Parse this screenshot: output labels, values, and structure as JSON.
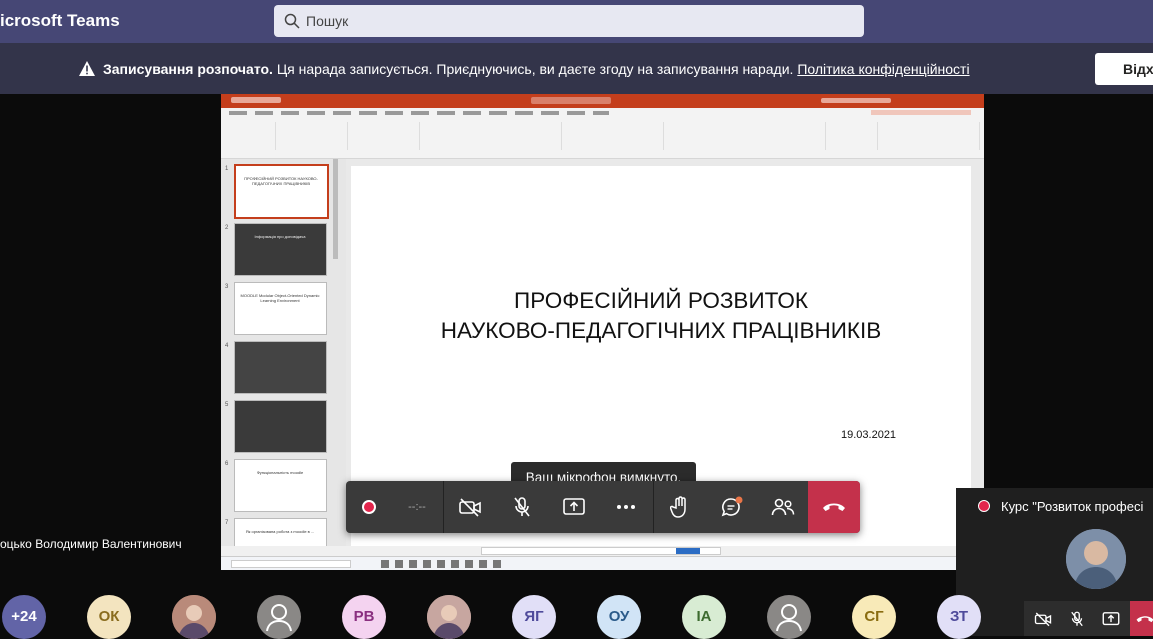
{
  "app": {
    "title": "icrosoft Teams"
  },
  "search": {
    "placeholder": "Пошук"
  },
  "banner": {
    "bold": "Записування розпочато.",
    "text": " Ця нарада записується. Приєднуючись, ви даєте згоду на записування наради. ",
    "link": "Політика конфіденційності",
    "dismiss_label": "Відх"
  },
  "slide": {
    "title_line1": "ПРОФЕСІЙНИЙ РОЗВИТОК",
    "title_line2": "НАУКОВО-ПЕДАГОГІЧНИХ ПРАЦІВНИКІВ",
    "date": "19.03.2021"
  },
  "thumbnails": [
    {
      "num": "1",
      "text": "ПРОФЕСІЙНИЙ РОЗВИТОК НАУКОВО-ПЕДАГОГІЧНИХ ПРАЦІВНИКІВ"
    },
    {
      "num": "2",
      "text": "Інформація про доповідача"
    },
    {
      "num": "3",
      "text": "MOODLE Modular Object-Oriented Dynamic Learning Environment"
    },
    {
      "num": "4",
      "text": ""
    },
    {
      "num": "5",
      "text": ""
    },
    {
      "num": "6",
      "text": "Функціональність moodle"
    },
    {
      "num": "7",
      "text": "Як організована робота з moodle в ..."
    }
  ],
  "tooltip": "Ваш мікрофон вимкнуто.",
  "call": {
    "timer": "--:--"
  },
  "presenter": {
    "name": "оцько Володимир Валентинович"
  },
  "self_preview": {
    "title": "Курс \"Розвиток професі"
  },
  "participants": [
    {
      "label": "+24",
      "bg": "#6264a7",
      "fg": "#ffffff"
    },
    {
      "label": "ОК",
      "bg": "#f3e4bf",
      "fg": "#8a6d1f"
    },
    {
      "label": "",
      "bg": "#b98a7a",
      "fg": "#ffffff",
      "photo": true
    },
    {
      "label": "",
      "bg": "#8a8886",
      "fg": "#ffffff",
      "generic": true
    },
    {
      "label": "РВ",
      "bg": "#f4d3f0",
      "fg": "#8a2f80"
    },
    {
      "label": "",
      "bg": "#c7a6a0",
      "fg": "#ffffff",
      "photo": true
    },
    {
      "label": "ЯГ",
      "bg": "#e1dff7",
      "fg": "#4f4b9b"
    },
    {
      "label": "ОУ",
      "bg": "#d1e4f6",
      "fg": "#2b5b8a"
    },
    {
      "label": "ІА",
      "bg": "#d8ecd3",
      "fg": "#3d6b2f"
    },
    {
      "label": "",
      "bg": "#8a8886",
      "fg": "#ffffff",
      "generic": true
    },
    {
      "label": "СГ",
      "bg": "#f8eab8",
      "fg": "#8a6d10"
    },
    {
      "label": "ЗТ",
      "bg": "#e1dff7",
      "fg": "#4f4b9b"
    }
  ]
}
